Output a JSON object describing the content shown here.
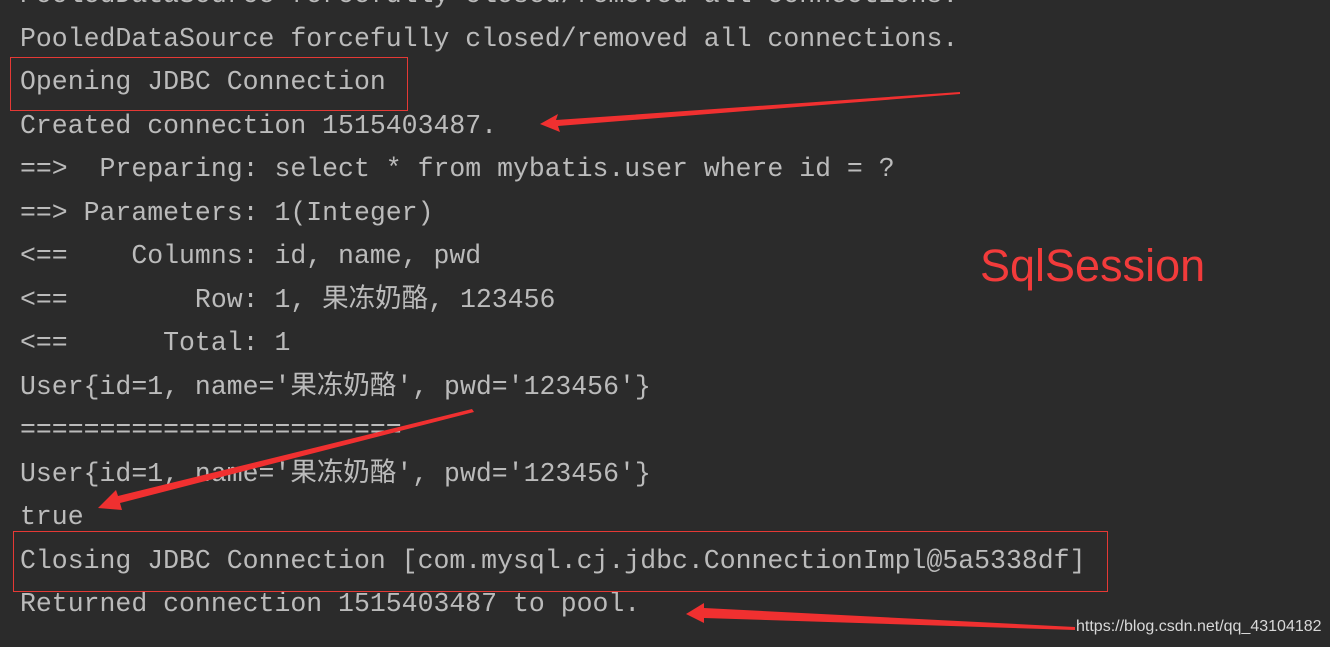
{
  "console": {
    "lines": [
      "PooledDataSource forcefully closed/removed all connections.",
      "PooledDataSource forcefully closed/removed all connections.",
      "Opening JDBC Connection",
      "Created connection 1515403487.",
      "==>  Preparing: select * from mybatis.user where id = ?",
      "==> Parameters: 1(Integer)",
      "<==    Columns: id, name, pwd",
      "<==        Row: 1, 果冻奶酪, 123456",
      "<==      Total: 1",
      "User{id=1, name='果冻奶酪', pwd='123456'}",
      "========================",
      "User{id=1, name='果冻奶酪', pwd='123456'}",
      "true",
      "Closing JDBC Connection [com.mysql.cj.jdbc.ConnectionImpl@5a5338df]",
      "Returned connection 1515403487 to pool."
    ]
  },
  "annotation": {
    "label": "SqlSession",
    "color": "#f23b3b"
  },
  "watermark": "https://blog.csdn.net/qq_43104182"
}
